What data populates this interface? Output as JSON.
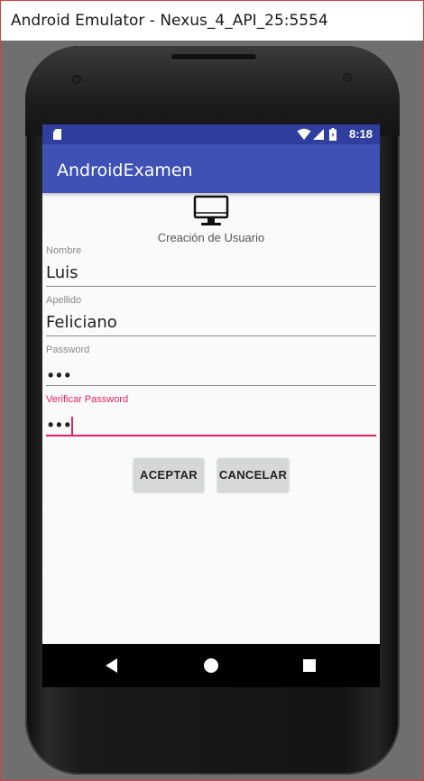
{
  "window": {
    "title": "Android Emulator - Nexus_4_API_25:5554"
  },
  "statusbar": {
    "time": "8:18",
    "icons": [
      "sd-card-icon",
      "wifi-icon",
      "signal-icon",
      "battery-icon"
    ]
  },
  "appbar": {
    "title": "AndroidExamen"
  },
  "header": {
    "icon": "desktop-monitor-icon",
    "caption": "Creación de Usuario"
  },
  "form": {
    "nombre": {
      "label": "Nombre",
      "value": "Luis"
    },
    "apellido": {
      "label": "Apellido",
      "value": "Feliciano"
    },
    "password": {
      "label": "Password",
      "value": "•••"
    },
    "verificar": {
      "label": "Verificar Password",
      "value": "•••"
    }
  },
  "buttons": {
    "accept": "ACEPTAR",
    "cancel": "CANCELAR"
  },
  "navbar": {
    "icons": [
      "back-icon",
      "home-icon",
      "recents-icon"
    ]
  },
  "colors": {
    "primary": "#3f51b5",
    "primary_dark": "#303f9f",
    "accent": "#e91e63"
  }
}
